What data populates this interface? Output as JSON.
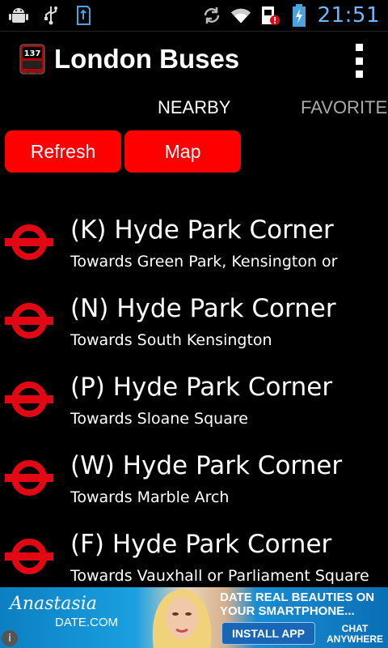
{
  "status_bar": {
    "time": "21:51",
    "left_icons": [
      "android-debug-icon",
      "usb-icon",
      "sd-card-icon"
    ],
    "right_icons": [
      "sync-icon",
      "wifi-icon",
      "sim-alert-icon",
      "battery-charging-icon"
    ]
  },
  "app": {
    "title": "London Buses",
    "icon": "bus-sign-icon",
    "icon_text": "137",
    "menu_icon": "overflow-menu-icon"
  },
  "tabs": {
    "nearby": "NEARBY",
    "favorites": "FAVORITE"
  },
  "buttons": {
    "refresh": "Refresh",
    "map": "Map"
  },
  "stops": [
    {
      "name": "(K) Hyde Park Corner",
      "direction": "Towards Green Park, Kensington or"
    },
    {
      "name": "(N) Hyde Park Corner",
      "direction": "Towards South Kensington"
    },
    {
      "name": "(P) Hyde Park Corner",
      "direction": "Towards Sloane Square"
    },
    {
      "name": "(W) Hyde Park Corner",
      "direction": "Towards Marble Arch"
    },
    {
      "name": "(F) Hyde Park Corner",
      "direction": "Towards Vauxhall or Parliament Square"
    }
  ],
  "ad": {
    "logo_script": "Anastasia",
    "logo_sub": "DATE.COM",
    "headline_line1": "DATE REAL BEAUTIES ON",
    "headline_line2": "YOUR SMARTPHONE...",
    "install_label": "INSTALL APP",
    "chat_line1": "CHAT",
    "chat_line2": "ANYWHERE",
    "info": "i"
  },
  "colors": {
    "background": "#000000",
    "button_red": "#ff0000",
    "roundel_red": "#e30613",
    "tab_inactive": "#aaaaaa",
    "clock": "#6fb7ff"
  }
}
